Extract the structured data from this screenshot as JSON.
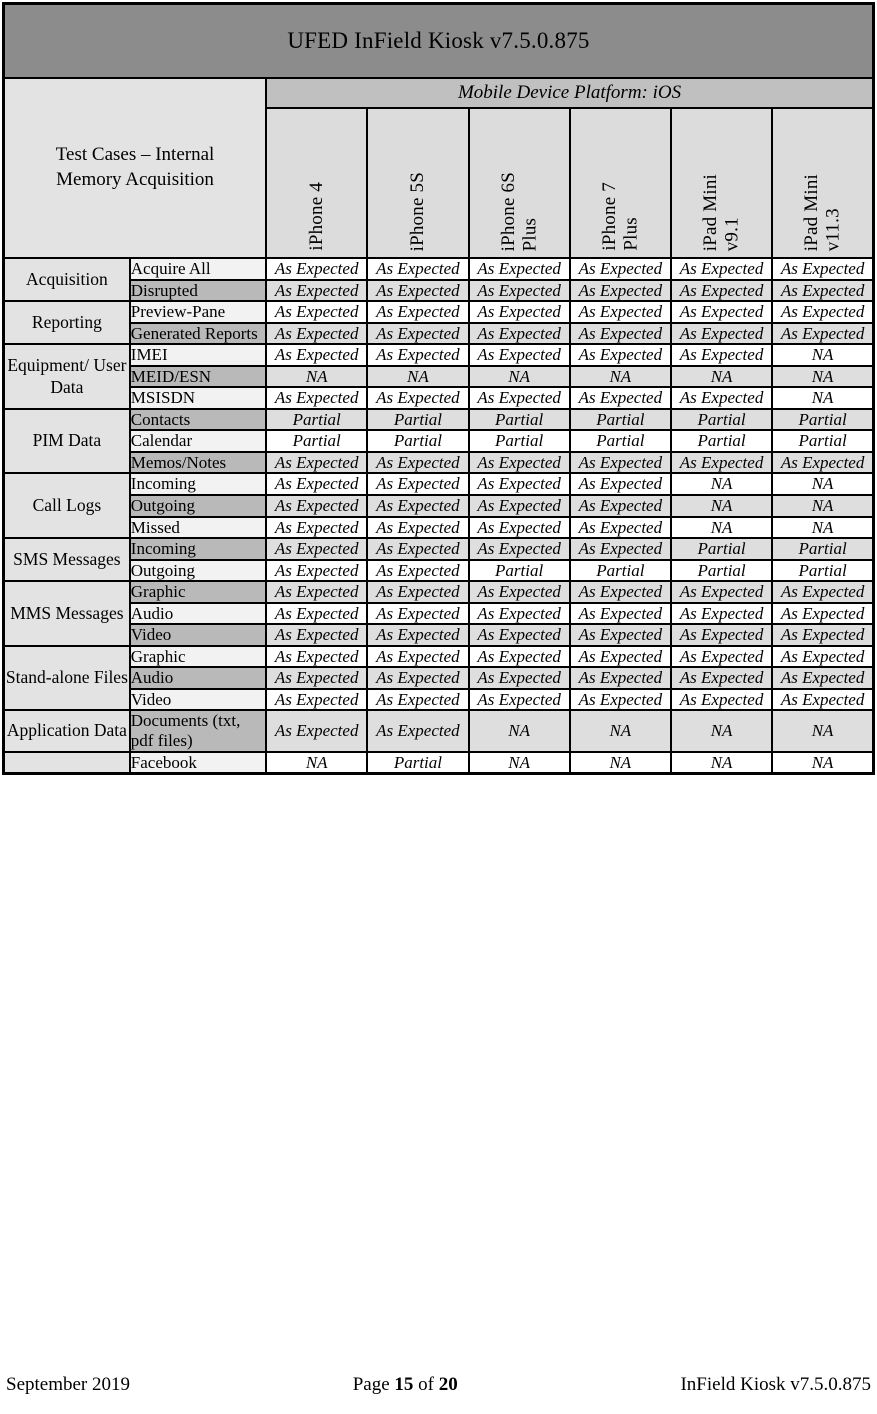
{
  "document": {
    "title": "UFED InField Kiosk v7.5.0.875",
    "platform_label": "Mobile Device Platform: iOS",
    "stub_line1": "Test Cases – Internal",
    "stub_line2": "Memory Acquisition"
  },
  "colors": {
    "title_bar": "#8c8c8c",
    "platform_strip": "#c0c0c0",
    "category_column": "#e3e3e3",
    "device_header": "#dcdcdc",
    "subtest_dark": "#b9b9b9",
    "subtest_light": "#f2f2f2",
    "result_dark": "#dedede",
    "result_light": "#ffffff",
    "border": "#000000"
  },
  "devices": [
    "iPhone 4",
    "iPhone 5S",
    "iPhone 6S\nPlus",
    "iPhone 7\nPlus",
    "iPad Mini\nv9.1",
    "iPad Mini\nv11.3"
  ],
  "groups": [
    {
      "category": "Acquisition",
      "rows": [
        {
          "label": "Acquire All",
          "shade": "light",
          "results": [
            "As Expected",
            "As Expected",
            "As Expected",
            "As Expected",
            "As Expected",
            "As Expected"
          ]
        },
        {
          "label": "Disrupted",
          "shade": "dark",
          "results": [
            "As Expected",
            "As Expected",
            "As Expected",
            "As Expected",
            "As Expected",
            "As Expected"
          ]
        }
      ]
    },
    {
      "category": "Reporting",
      "rows": [
        {
          "label": "Preview-Pane",
          "shade": "light",
          "results": [
            "As Expected",
            "As Expected",
            "As Expected",
            "As Expected",
            "As Expected",
            "As Expected"
          ]
        },
        {
          "label": "Generated Reports",
          "shade": "dark",
          "results": [
            "As Expected",
            "As Expected",
            "As Expected",
            "As Expected",
            "As Expected",
            "As Expected"
          ]
        }
      ]
    },
    {
      "category": "Equipment/ User Data",
      "rows": [
        {
          "label": "IMEI",
          "shade": "light",
          "results": [
            "As Expected",
            "As Expected",
            "As Expected",
            "As Expected",
            "As Expected",
            "NA"
          ]
        },
        {
          "label": "MEID/ESN",
          "shade": "dark",
          "results": [
            "NA",
            "NA",
            "NA",
            "NA",
            "NA",
            "NA"
          ]
        },
        {
          "label": "MSISDN",
          "shade": "light",
          "results": [
            "As Expected",
            "As Expected",
            "As Expected",
            "As Expected",
            "As Expected",
            "NA"
          ]
        }
      ]
    },
    {
      "category": "PIM Data",
      "rows": [
        {
          "label": "Contacts",
          "shade": "dark",
          "results": [
            "Partial",
            "Partial",
            "Partial",
            "Partial",
            "Partial",
            "Partial"
          ]
        },
        {
          "label": "Calendar",
          "shade": "light",
          "results": [
            "Partial",
            "Partial",
            "Partial",
            "Partial",
            "Partial",
            "Partial"
          ]
        },
        {
          "label": "Memos/Notes",
          "shade": "dark",
          "results": [
            "As Expected",
            "As Expected",
            "As Expected",
            "As Expected",
            "As Expected",
            "As Expected"
          ]
        }
      ]
    },
    {
      "category": "Call Logs",
      "rows": [
        {
          "label": "Incoming",
          "shade": "light",
          "results": [
            "As Expected",
            "As Expected",
            "As Expected",
            "As Expected",
            "NA",
            "NA"
          ]
        },
        {
          "label": "Outgoing",
          "shade": "dark",
          "results": [
            "As Expected",
            "As Expected",
            "As Expected",
            "As Expected",
            "NA",
            "NA"
          ]
        },
        {
          "label": "Missed",
          "shade": "light",
          "results": [
            "As Expected",
            "As Expected",
            "As Expected",
            "As Expected",
            "NA",
            "NA"
          ]
        }
      ]
    },
    {
      "category": "SMS Messages",
      "rows": [
        {
          "label": "Incoming",
          "shade": "dark",
          "results": [
            "As Expected",
            "As Expected",
            "As Expected",
            "As Expected",
            "Partial",
            "Partial"
          ]
        },
        {
          "label": "Outgoing",
          "shade": "light",
          "results": [
            "As Expected",
            "As Expected",
            "Partial",
            "Partial",
            "Partial",
            "Partial"
          ]
        }
      ]
    },
    {
      "category": "MMS Messages",
      "rows": [
        {
          "label": "Graphic",
          "shade": "dark",
          "results": [
            "As Expected",
            "As Expected",
            "As Expected",
            "As Expected",
            "As Expected",
            "As Expected"
          ]
        },
        {
          "label": "Audio",
          "shade": "light",
          "results": [
            "As Expected",
            "As Expected",
            "As Expected",
            "As Expected",
            "As Expected",
            "As Expected"
          ]
        },
        {
          "label": "Video",
          "shade": "dark",
          "results": [
            "As Expected",
            "As Expected",
            "As Expected",
            "As Expected",
            "As Expected",
            "As Expected"
          ]
        }
      ]
    },
    {
      "category": "Stand-alone Files",
      "rows": [
        {
          "label": "Graphic",
          "shade": "light",
          "results": [
            "As Expected",
            "As Expected",
            "As Expected",
            "As Expected",
            "As Expected",
            "As Expected"
          ]
        },
        {
          "label": "Audio",
          "shade": "dark",
          "results": [
            "As Expected",
            "As Expected",
            "As Expected",
            "As Expected",
            "As Expected",
            "As Expected"
          ]
        },
        {
          "label": "Video",
          "shade": "light",
          "results": [
            "As Expected",
            "As Expected",
            "As Expected",
            "As Expected",
            "As Expected",
            "As Expected"
          ]
        }
      ]
    },
    {
      "category": "Application Data",
      "rows": [
        {
          "label": "Documents (txt, pdf files)",
          "shade": "dark",
          "results": [
            "As Expected",
            "As Expected",
            "NA",
            "NA",
            "NA",
            "NA"
          ]
        }
      ]
    },
    {
      "category": "",
      "rows": [
        {
          "label": "Facebook",
          "shade": "light",
          "results": [
            "NA",
            "Partial",
            "NA",
            "NA",
            "NA",
            "NA"
          ]
        }
      ]
    }
  ],
  "footer": {
    "left": "September 2019",
    "page_prefix": "Page ",
    "page_number": "15",
    "page_middle": " of ",
    "page_total": "20",
    "right": "InField Kiosk v7.5.0.875"
  }
}
